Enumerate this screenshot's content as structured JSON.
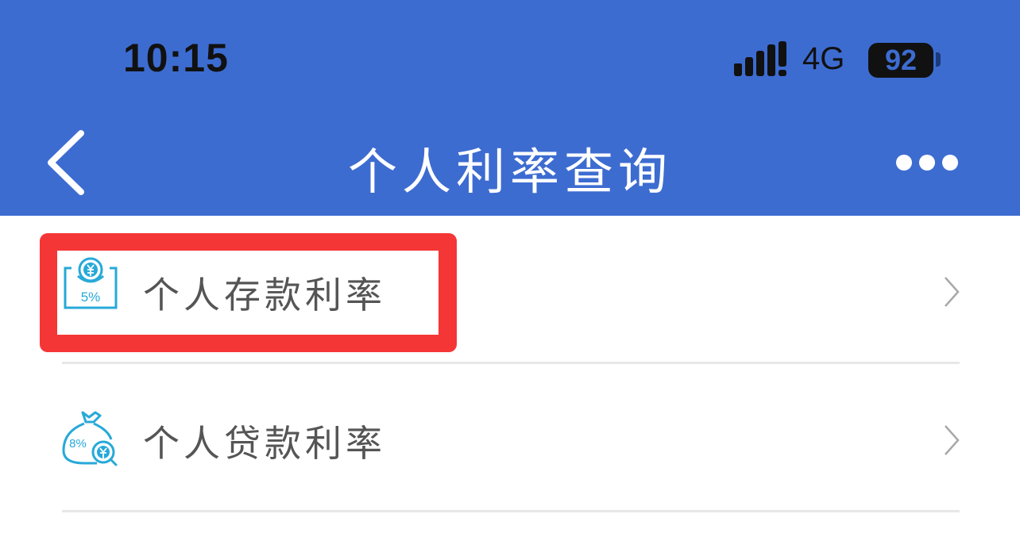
{
  "status_bar": {
    "time": "10:15",
    "network": "4G",
    "battery": "92"
  },
  "nav": {
    "title": "个人利率查询"
  },
  "menu": {
    "items": [
      {
        "label": "个人存款利率",
        "icon_text": "5%"
      },
      {
        "label": "个人贷款利率",
        "icon_text": "8%"
      }
    ]
  },
  "colors": {
    "header": "#3d6cd1",
    "highlight": "#f53636",
    "icon": "#27a9d8"
  }
}
